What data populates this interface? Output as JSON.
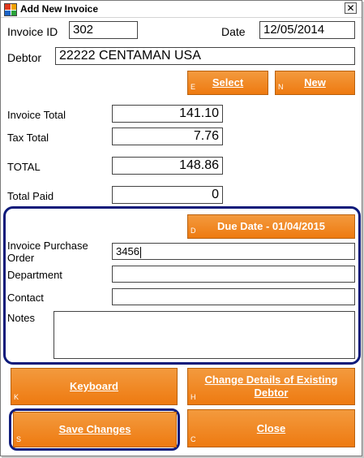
{
  "window": {
    "title": "Add New Invoice",
    "close_glyph": "✕"
  },
  "invoice": {
    "id_label": "Invoice ID",
    "id_value": "302",
    "date_label": "Date",
    "date_value": "12/05/2014",
    "debtor_label": "Debtor",
    "debtor_value": "22222 CENTAMAN USA"
  },
  "debtor_buttons": {
    "select": {
      "label": "Select",
      "hotkey": "E"
    },
    "new": {
      "label": "New",
      "hotkey": "N"
    }
  },
  "totals": {
    "invoice_total_label": "Invoice Total",
    "invoice_total_value": "141.10",
    "tax_total_label": "Tax Total",
    "tax_total_value": "7.76",
    "total_label": "TOTAL",
    "total_value": "148.86",
    "total_paid_label": "Total Paid",
    "total_paid_value": "0"
  },
  "details": {
    "due_date_button": {
      "label": "Due Date - 01/04/2015",
      "hotkey": "D"
    },
    "po_label_line1": "Invoice Purchase",
    "po_label_line2": "Order",
    "po_value": "3456",
    "department_label": "Department",
    "department_value": "",
    "contact_label": "Contact",
    "contact_value": "",
    "notes_label": "Notes",
    "notes_value": ""
  },
  "actions": {
    "keyboard": {
      "label": "Keyboard",
      "hotkey": "K"
    },
    "change_details": {
      "label": "Change Details of Existing Debtor",
      "hotkey": "H"
    },
    "save": {
      "label": "Save Changes",
      "hotkey": "S"
    },
    "close": {
      "label": "Close",
      "hotkey": "C"
    }
  },
  "colors": {
    "button_orange": "#ee7a10",
    "highlight_navy": "#0d1a7a"
  }
}
